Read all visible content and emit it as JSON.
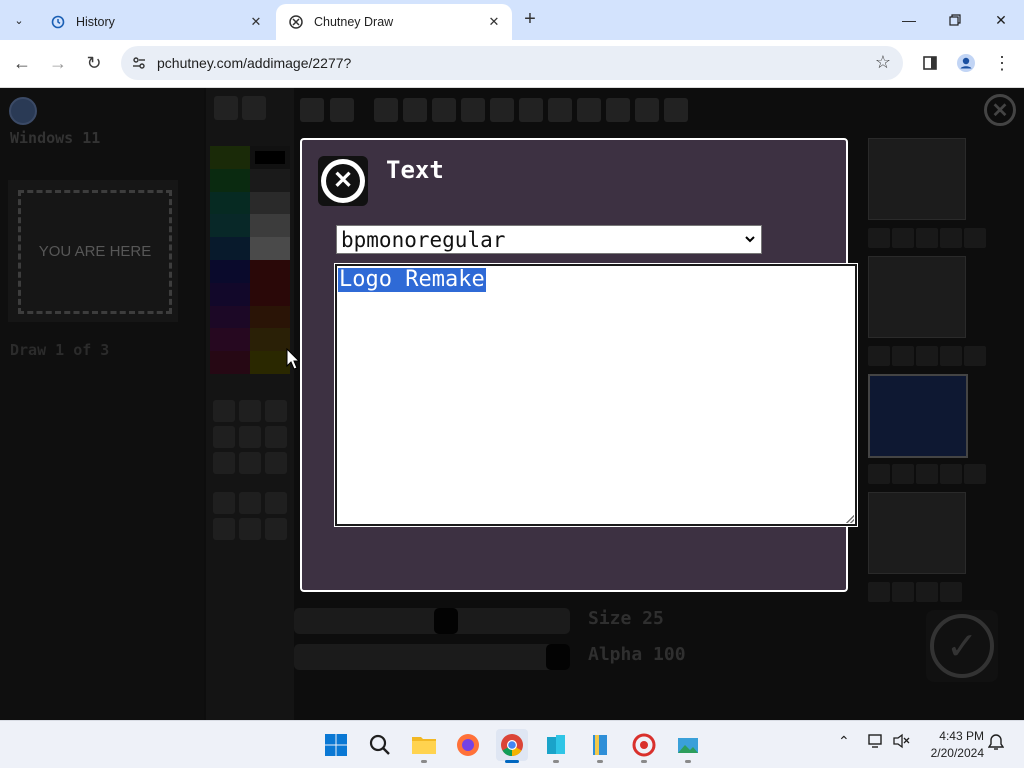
{
  "browser": {
    "tabs": [
      {
        "title": "History",
        "icon": "history-icon",
        "active": false
      },
      {
        "title": "Chutney Draw",
        "icon": "chutney-icon",
        "active": true
      }
    ],
    "url": "pchutney.com/addimage/2277?"
  },
  "app": {
    "window_label": "Windows 11",
    "placeholder_text": "YOU ARE HERE",
    "draw_counter": "Draw 1 of 3",
    "size_label": "Size 25",
    "alpha_label": "Alpha 100",
    "size_value": 25,
    "alpha_value": 100,
    "swatch_colors": [
      "#1a2a08",
      "#111111",
      "#0a2a10",
      "#1a1a1a",
      "#062a22",
      "#2a2a2a",
      "#082828",
      "#3c3c3c",
      "#081a2c",
      "#4a4a4a",
      "#0a0a2c",
      "#2a0808",
      "#12082a",
      "#2a0808",
      "#1c0826",
      "#2a1406",
      "#260820",
      "#2a2006",
      "#260814",
      "#2a2800"
    ]
  },
  "dialog": {
    "title": "Text",
    "font_value": "bpmonoregular",
    "text_value": "Logo Remake"
  },
  "taskbar": {
    "apps": [
      "start-icon",
      "search-icon",
      "file-explorer-icon",
      "firefox-icon",
      "chrome-icon",
      "app-blue-icon",
      "app-book-icon",
      "app-red-icon",
      "app-photo-icon"
    ],
    "time": "4:43 PM",
    "date": "2/20/2024"
  }
}
